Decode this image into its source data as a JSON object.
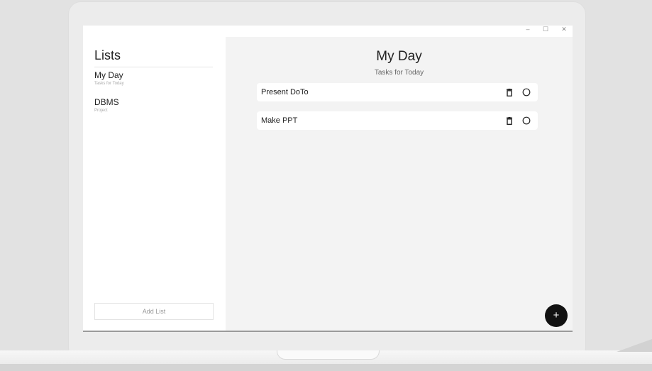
{
  "window": {
    "minimize": "–",
    "maximize": "☐",
    "close": "✕"
  },
  "sidebar": {
    "title": "Lists",
    "items": [
      {
        "name": "My Day",
        "subtitle": "Tasks for Today"
      },
      {
        "name": "DBMS",
        "subtitle": "Project"
      }
    ],
    "add_list_label": "Add List"
  },
  "main": {
    "title": "My Day",
    "subtitle": "Tasks for Today",
    "tasks": [
      {
        "text": "Present DoTo"
      },
      {
        "text": "Make PPT"
      }
    ],
    "fab_label": "+"
  }
}
